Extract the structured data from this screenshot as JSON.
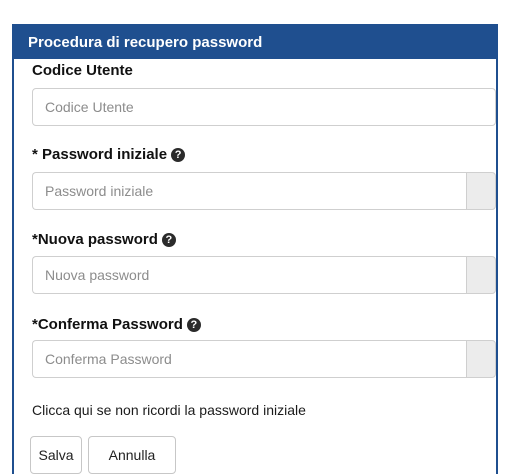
{
  "header": {
    "title": "Procedura di recupero password"
  },
  "form": {
    "user_code": {
      "label": "Codice Utente",
      "placeholder": "Codice Utente"
    },
    "initial_password": {
      "label": "* Password iniziale",
      "placeholder": "Password iniziale",
      "help_icon": "question-circle-icon"
    },
    "new_password": {
      "label": "*Nuova password",
      "placeholder": "Nuova password",
      "help_icon": "question-circle-icon"
    },
    "confirm_password": {
      "label": "*Conferma Password",
      "placeholder": "Conferma Password",
      "help_icon": "question-circle-icon"
    },
    "forgot_link": "Clicca qui se non ricordi la password iniziale"
  },
  "buttons": {
    "save": "Salva",
    "cancel": "Annulla"
  },
  "colors": {
    "header_bg": "#1f4f8f",
    "border": "#1f4f8f"
  }
}
